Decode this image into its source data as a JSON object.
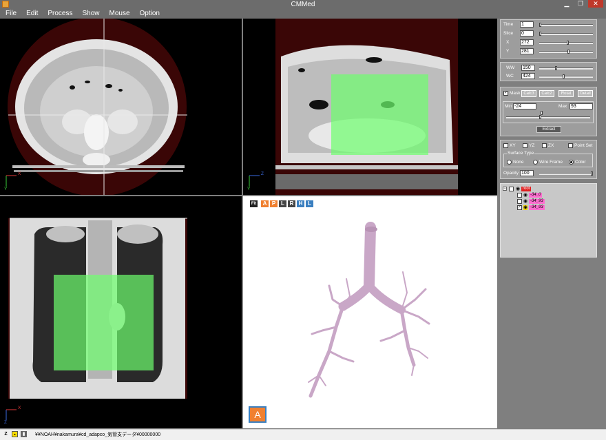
{
  "window": {
    "title": "CMMed"
  },
  "menu": [
    "File",
    "Edit",
    "Process",
    "Show",
    "Mouse",
    "Option"
  ],
  "controls": {
    "time": {
      "label": "Time",
      "value": "1",
      "fraction": 0.0
    },
    "slice": {
      "label": "Slice",
      "value": "0",
      "fraction": 0.0
    },
    "x": {
      "label": "X",
      "value": "272",
      "fraction": 0.53
    },
    "y": {
      "label": "Y",
      "value": "281",
      "fraction": 0.55
    }
  },
  "window_level": {
    "ww": {
      "label": "WW",
      "value": "150",
      "fraction": 0.3
    },
    "wc": {
      "label": "WC",
      "value": "424",
      "fraction": 0.45
    }
  },
  "mask": {
    "checkbox_label": "Mask",
    "checked": true,
    "buttons": [
      "Calc3",
      "Calc2",
      "Rotat",
      "Detail"
    ],
    "min_label": "Min",
    "min_value": "-24",
    "max_label": "Max",
    "max_value": "93",
    "min_fraction": 0.4,
    "max_fraction": 0.42,
    "extract_label": "Extract"
  },
  "surface": {
    "planes": [
      {
        "label": "XY",
        "checked": false
      },
      {
        "label": "YZ",
        "checked": false
      },
      {
        "label": "ZX",
        "checked": false
      }
    ],
    "point_set_label": "Point Set",
    "group_label": "Surface Type",
    "types": [
      {
        "label": "None",
        "selected": false
      },
      {
        "label": "Wire Frame",
        "selected": false
      },
      {
        "label": "Color",
        "selected": true
      }
    ],
    "opacity_label": "Opacity",
    "opacity_value": "100",
    "opacity_fraction": 1.0
  },
  "tree": {
    "root_label": "root",
    "nodes": [
      {
        "label": "-34_0",
        "checked": false,
        "color": "#ff6fd0"
      },
      {
        "label": "-34_93",
        "checked": false,
        "color": "#ff6fd0"
      },
      {
        "label": "-34_93",
        "checked": true,
        "color": "#ff6fd0"
      }
    ]
  },
  "viewer3d": {
    "toolbar": [
      "Fit",
      "A",
      "P",
      "L",
      "R",
      "H",
      "L"
    ],
    "orient_cube_label": "A"
  },
  "views": {
    "axial_axes": {
      "x": "X",
      "y": "Y"
    },
    "sag_axes": {
      "x": "Z",
      "y": "Y"
    },
    "cor_axes": {
      "x": "X",
      "y": "Z"
    }
  },
  "status": {
    "path": "¥¥NOAH¥nakamura¥cd_adapco_気管支データ¥00000000"
  },
  "colors": {
    "mask_green": "#6eff6e",
    "airway": "#c9a7c7",
    "accent_orange": "#f08030",
    "accent_blue": "#3a7fc0"
  }
}
